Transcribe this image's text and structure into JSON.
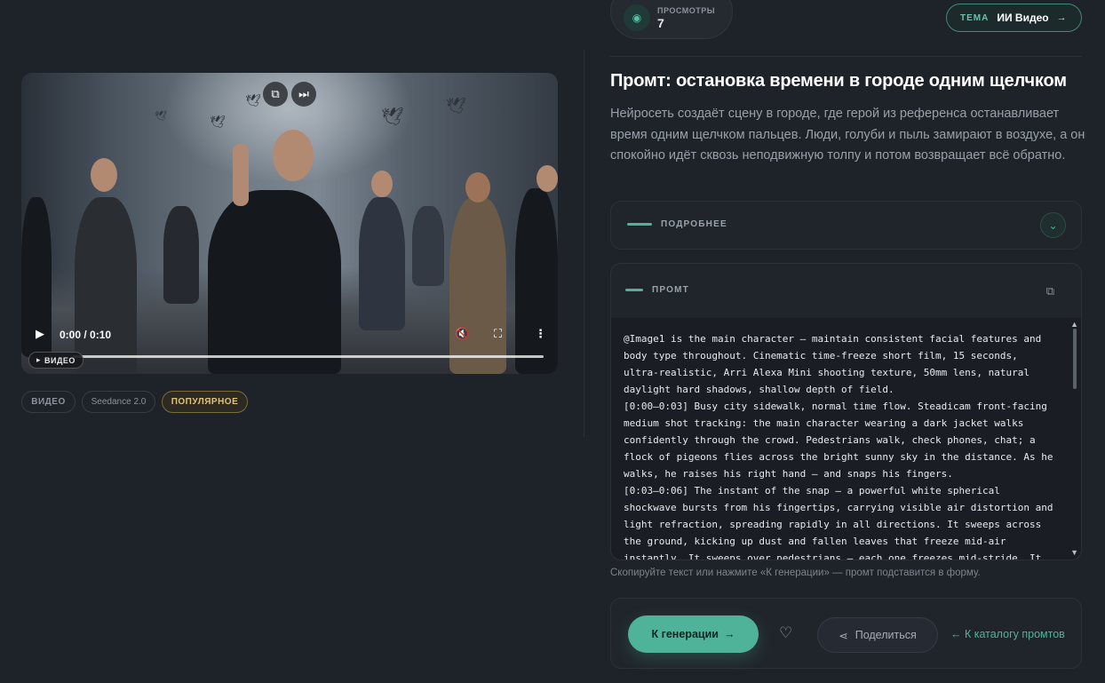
{
  "views": {
    "label": "ПРОСМОТРЫ",
    "value": "7",
    "icon": "eye-icon"
  },
  "theme": {
    "label": "ТЕМА",
    "value": "ИИ Видео",
    "arrow": "→"
  },
  "title": "Промт: остановка времени в городе одним щелчком",
  "description": "Нейросеть создаёт сцену в городе, где герой из референса останавливает время одним щелчком пальцев. Люди, голуби и пыль замирают в воздухе, а он спокойно идёт сквозь неподвижную толпу и потом возвращает всё обратно.",
  "details": {
    "label": "ПОДРОБНЕЕ",
    "chevron": "⌄"
  },
  "prompt": {
    "label": "ПРОМТ",
    "copy_icon": "⧉",
    "text": "@Image1 is the main character — maintain consistent facial features and body type throughout. Cinematic time-freeze short film, 15 seconds, ultra-realistic, Arri Alexa Mini shooting texture, 50mm lens, natural daylight hard shadows, shallow depth of field.\n[0:00–0:03] Busy city sidewalk, normal time flow. Steadicam front-facing medium shot tracking: the main character wearing a dark jacket walks confidently through the crowd. Pedestrians walk, check phones, chat; a flock of pigeons flies across the bright sunny sky in the distance. As he walks, he raises his right hand — and snaps his fingers.\n[0:03–0:06] The instant of the snap — a powerful white spherical shockwave bursts from his fingertips, carrying visible air distortion and light refraction, spreading rapidly in all directions. It sweeps across the ground, kicking up dust and fallen leaves that freeze mid-air instantly. It sweeps over pedestrians — each one freezes mid-stride. It sweeps across the"
  },
  "hint": "Скопируйте текст или нажмите «К генерации» — промт подставится в форму.",
  "actions": {
    "generate": "К генерации",
    "generate_arrow": "→",
    "share": "Поделиться",
    "catalog": "← К каталогу промтов"
  },
  "video": {
    "time": "0:00 / 0:10",
    "badge": "ВИДЕО",
    "progress": 0
  },
  "tags": [
    "ВИДЕО",
    "Seedance 2.0",
    "ПОПУЛЯРНОЕ"
  ]
}
